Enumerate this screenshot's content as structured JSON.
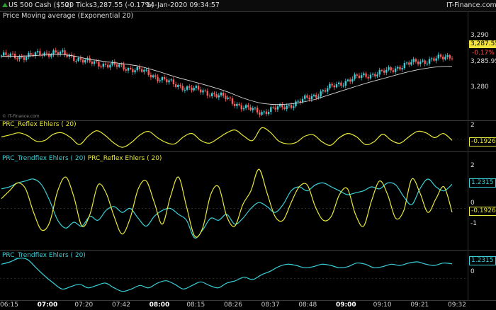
{
  "header": {
    "instrument": "US 500 Cash ($50)",
    "timeframe": "20 Ticks",
    "price_change": "3,287.55 (-0.17%)",
    "timestamp": "14-Jan-2020 09:34:57",
    "brand": "IT-Finance.com"
  },
  "price_pane": {
    "title": "Price Moving average (Exponential 20)",
    "watermark": "© IT-Finance.com",
    "tick_top": "3,290",
    "last_price": "3,287.55",
    "change_pct": "-0.17%",
    "ema_value": "3,285.95",
    "tick_bottom": "3,280"
  },
  "reflex_pane": {
    "title": "PRC_Reflex Ehlers ( 20)",
    "tick_top": "2",
    "value": "-0.1926"
  },
  "combined_pane": {
    "title_a": "PRC_Trendflex Ehlers ( 20)",
    "title_b": "PRC_Reflex Ehlers ( 20)",
    "tick_2": "2",
    "trendflex_value": "1.2315",
    "tick_0": "0",
    "reflex_value": "-0.1926",
    "tick_m1": "-1"
  },
  "trendflex_pane": {
    "title": "PRC_Trendflex Ehlers ( 20)",
    "value": "1.2315",
    "tick_0": "0"
  },
  "colors": {
    "up": "#39d0d8",
    "down": "#ff5a5a",
    "ema": "#d8d8d8",
    "reflex": "#e8e83a",
    "trendflex": "#39d0d8"
  },
  "chart_data": [
    {
      "type": "line",
      "title": "Price Moving average (Exponential 20)",
      "series": [
        {
          "name": "Price",
          "x": [
            "06:15",
            "06:30",
            "06:45",
            "07:00",
            "07:10",
            "07:20",
            "07:30",
            "07:42",
            "07:50",
            "08:00",
            "08:05",
            "08:10",
            "08:15",
            "08:20",
            "08:26",
            "08:32",
            "08:37",
            "08:42",
            "08:48",
            "08:54",
            "09:00",
            "09:05",
            "09:10",
            "09:16",
            "09:21",
            "09:26",
            "09:32"
          ],
          "values": [
            3287.5,
            3287.3,
            3287.6,
            3288.0,
            3287.4,
            3286.5,
            3286.2,
            3285.8,
            3285.3,
            3284.3,
            3283.2,
            3282.6,
            3282.0,
            3281.2,
            3279.8,
            3279.2,
            3279.8,
            3280.5,
            3281.6,
            3282.8,
            3283.9,
            3284.6,
            3285.0,
            3285.9,
            3286.6,
            3286.9,
            3287.55
          ]
        },
        {
          "name": "Exponential 20",
          "x": [
            "06:15",
            "06:30",
            "06:45",
            "07:00",
            "07:10",
            "07:20",
            "07:30",
            "07:42",
            "07:50",
            "08:00",
            "08:05",
            "08:10",
            "08:15",
            "08:20",
            "08:26",
            "08:32",
            "08:37",
            "08:42",
            "08:48",
            "08:54",
            "09:00",
            "09:05",
            "09:10",
            "09:16",
            "09:21",
            "09:26",
            "09:32"
          ],
          "values": [
            3287.4,
            3287.4,
            3287.5,
            3287.7,
            3287.5,
            3287.0,
            3286.6,
            3286.3,
            3285.9,
            3285.2,
            3284.4,
            3283.7,
            3283.0,
            3282.2,
            3281.2,
            3280.5,
            3280.3,
            3280.5,
            3281.0,
            3281.8,
            3282.6,
            3283.4,
            3284.1,
            3284.8,
            3285.4,
            3285.8,
            3285.95
          ]
        }
      ],
      "ylim": [
        3278.5,
        3291.5
      ],
      "yticks": [
        "3,290",
        "3,280"
      ]
    },
    {
      "type": "line",
      "title": "PRC_Reflex Ehlers ( 20)",
      "series": [
        {
          "name": "PRC_Reflex Ehlers ( 20)",
          "values": [
            0.3,
            0.6,
            0.9,
            0.5,
            -0.3,
            -0.2,
            0.7,
            0.9,
            0.2,
            -0.8,
            0.4,
            1.2,
            0.5,
            -0.6,
            -1.2,
            -0.5,
            0.6,
            1.1,
            0.2,
            -0.5,
            -0.7,
            0.3,
            0.8,
            -0.2,
            -0.6,
            0.1,
            0.9,
            1.3,
            0.4,
            -0.2,
            1.6,
            1.0,
            -0.3,
            -0.7,
            -0.5,
            0.4,
            0.6,
            -0.4,
            -0.9,
            0.2,
            0.8,
            0.3,
            -0.8,
            -0.4,
            0.7,
            -0.2,
            -0.6,
            0.3,
            1.1,
            0.9,
            0.2,
            0.8,
            -0.1926
          ]
        }
      ],
      "ylim": [
        -1.6,
        2.2
      ],
      "yticks": [
        "2"
      ]
    },
    {
      "type": "line",
      "title": "PRC_Trendflex Ehlers ( 20) PRC_Reflex Ehlers ( 20)",
      "series": [
        {
          "name": "PRC_Trendflex Ehlers ( 20)",
          "values": [
            1.0,
            1.1,
            1.3,
            1.4,
            1.5,
            1.2,
            0.4,
            -0.6,
            -1.0,
            -0.7,
            -0.9,
            -0.4,
            -0.6,
            -0.1,
            0.1,
            -0.2,
            0.0,
            -0.5,
            -0.9,
            -0.4,
            -0.1,
            0.0,
            -0.3,
            -0.6,
            -1.5,
            -1.1,
            -0.5,
            -0.6,
            -0.3,
            -0.8,
            -0.5,
            0.0,
            0.3,
            0.1,
            -0.2,
            0.2,
            0.9,
            1.1,
            0.9,
            1.2,
            1.3,
            1.1,
            0.9,
            0.7,
            0.8,
            0.9,
            1.1,
            1.0,
            1.3,
            1.2,
            0.6,
            0.2,
            1.0,
            1.5,
            1.1,
            0.9,
            1.2315
          ]
        },
        {
          "name": "PRC_Reflex Ehlers ( 20)",
          "values": [
            0.5,
            0.9,
            1.3,
            1.0,
            -0.2,
            -1.1,
            -0.7,
            0.9,
            1.6,
            0.6,
            -0.9,
            -0.3,
            1.2,
            0.8,
            -0.4,
            -1.3,
            -0.5,
            1.0,
            1.4,
            0.3,
            -0.8,
            0.6,
            1.6,
            0.1,
            -1.4,
            -1.0,
            0.7,
            1.1,
            -0.4,
            -0.9,
            0.2,
            0.9,
            2.0,
            0.8,
            -0.4,
            -0.6,
            0.3,
            1.1,
            1.2,
            0.1,
            -0.6,
            -0.4,
            0.7,
            1.0,
            -0.3,
            -0.9,
            0.4,
            1.4,
            0.7,
            -0.5,
            -0.1,
            1.5,
            0.8,
            -0.2,
            0.5,
            1.1,
            -0.1926
          ]
        }
      ],
      "ylim": [
        -2.0,
        2.4
      ],
      "yticks": [
        "2",
        "0",
        "-1"
      ]
    },
    {
      "type": "line",
      "title": "PRC_Trendflex Ehlers ( 20)",
      "series": [
        {
          "name": "PRC_Trendflex Ehlers ( 20)",
          "values": [
            1.2,
            1.4,
            1.7,
            1.6,
            0.9,
            0.2,
            -0.4,
            -0.9,
            -0.7,
            -0.5,
            -0.8,
            -0.6,
            -0.4,
            -0.8,
            -1.1,
            -0.9,
            -0.6,
            -0.8,
            -0.4,
            -0.2,
            -0.5,
            -0.9,
            -0.6,
            -0.3,
            -0.6,
            -0.8,
            -0.4,
            -0.2,
            0.1,
            -0.1,
            0.3,
            0.6,
            1.0,
            1.2,
            1.1,
            0.9,
            1.0,
            1.2,
            1.1,
            0.9,
            1.0,
            1.3,
            1.2,
            0.9,
            1.0,
            1.2,
            1.1,
            1.3,
            1.4,
            1.2,
            1.1,
            1.3,
            1.2315
          ]
        }
      ],
      "ylim": [
        -1.6,
        2.0
      ],
      "yticks": [
        "0"
      ]
    }
  ],
  "x_axis": {
    "labels": [
      {
        "text": "06:15",
        "bold": false
      },
      {
        "text": "07:00",
        "bold": true
      },
      {
        "text": "07:20",
        "bold": false
      },
      {
        "text": "07:42",
        "bold": false
      },
      {
        "text": "08:00",
        "bold": true
      },
      {
        "text": "08:15",
        "bold": false
      },
      {
        "text": "08:26",
        "bold": false
      },
      {
        "text": "08:37",
        "bold": false
      },
      {
        "text": "08:48",
        "bold": false
      },
      {
        "text": "09:00",
        "bold": true
      },
      {
        "text": "09:10",
        "bold": false
      },
      {
        "text": "09:21",
        "bold": false
      },
      {
        "text": "09:32",
        "bold": false
      }
    ]
  }
}
